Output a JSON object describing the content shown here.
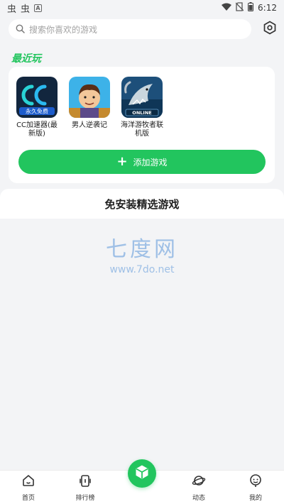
{
  "status_bar": {
    "time": "6:12",
    "left_glyphs": [
      "虫",
      "虫"
    ],
    "a_badge": "A"
  },
  "search": {
    "placeholder": "搜索你喜欢的游戏"
  },
  "recent": {
    "title": "最近玩",
    "games": [
      {
        "name": "CC加速器(最新版)",
        "icon_badge": "永久免费"
      },
      {
        "name": "男人逆袭记"
      },
      {
        "name": "海洋游牧者联机版",
        "icon_badge": "ONLINE"
      }
    ],
    "add_button_label": "添加游戏"
  },
  "featured": {
    "title": "免安装精选游戏"
  },
  "watermark": {
    "title": "七度网",
    "url": "www.7do.net"
  },
  "bottom_nav": {
    "items": [
      {
        "label": "首页",
        "icon": "home-icon"
      },
      {
        "label": "排行榜",
        "icon": "ranking-icon"
      },
      {
        "label": "",
        "icon": "cube-icon"
      },
      {
        "label": "动态",
        "icon": "planet-icon"
      },
      {
        "label": "我的",
        "icon": "profile-icon"
      }
    ]
  },
  "colors": {
    "accent": "#22c55e",
    "background": "#f3f4f6",
    "watermark": "#9fc0e6"
  }
}
